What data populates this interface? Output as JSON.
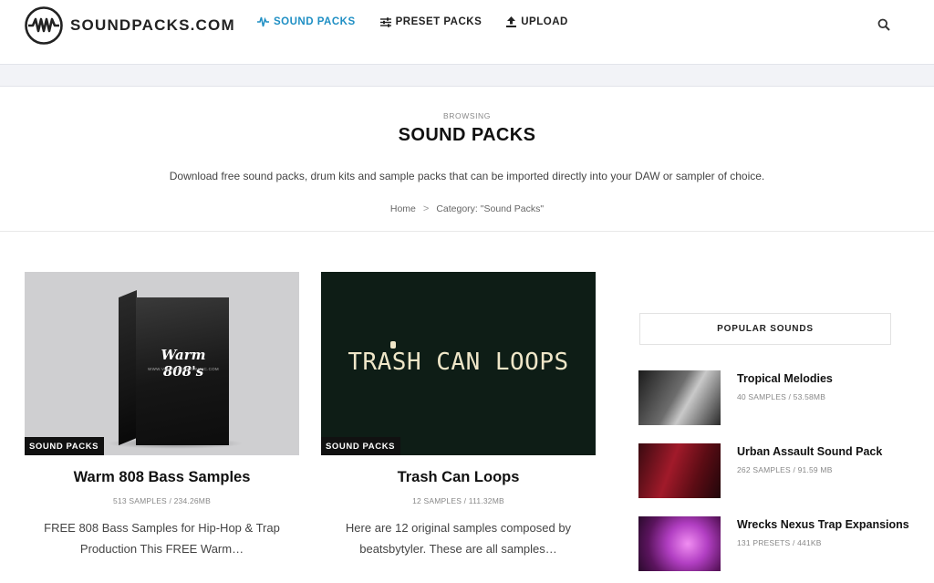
{
  "header": {
    "logo_text": "SOUNDPACKS.COM",
    "nav": [
      {
        "label": "SOUND PACKS",
        "icon": "waveform-icon",
        "active": true
      },
      {
        "label": "PRESET PACKS",
        "icon": "sliders-icon",
        "active": false
      },
      {
        "label": "UPLOAD",
        "icon": "upload-icon",
        "active": false
      }
    ],
    "accent_color": "#1f8fc4"
  },
  "archive": {
    "eyebrow": "BROWSING",
    "title": "SOUND PACKS",
    "description": "Download free sound packs, drum kits and sample packs that can be imported directly into your DAW or sampler of choice.",
    "breadcrumb": {
      "home": "Home",
      "separator": ">",
      "current": "Category: \"Sound Packs\""
    }
  },
  "posts": [
    {
      "category": "SOUND PACKS",
      "title": "Warm 808 Bass Samples",
      "meta": "513 SAMPLES / 234.26MB",
      "excerpt": "FREE 808 Bass Samples for Hip-Hop & Trap Production This FREE Warm…",
      "image_text": "Warm 808's",
      "image_subtext": "WWW.VISUALSCALEMUSIC.COM"
    },
    {
      "category": "SOUND PACKS",
      "title": "Trash Can Loops",
      "meta": "12 SAMPLES / 111.32MB",
      "excerpt": "Here are 12 original samples composed by beatsbytyler. These are all samples…",
      "image_text": "TRASH CAN LOOPS"
    }
  ],
  "sidebar": {
    "widget_title": "POPULAR SOUNDS",
    "items": [
      {
        "title": "Tropical Melodies",
        "meta": "40 SAMPLES / 53.58MB"
      },
      {
        "title": "Urban Assault Sound Pack",
        "meta": "262 SAMPLES / 91.59 MB"
      },
      {
        "title": "Wrecks Nexus Trap Expansions",
        "meta": "131 PRESETS / 441KB"
      }
    ]
  }
}
